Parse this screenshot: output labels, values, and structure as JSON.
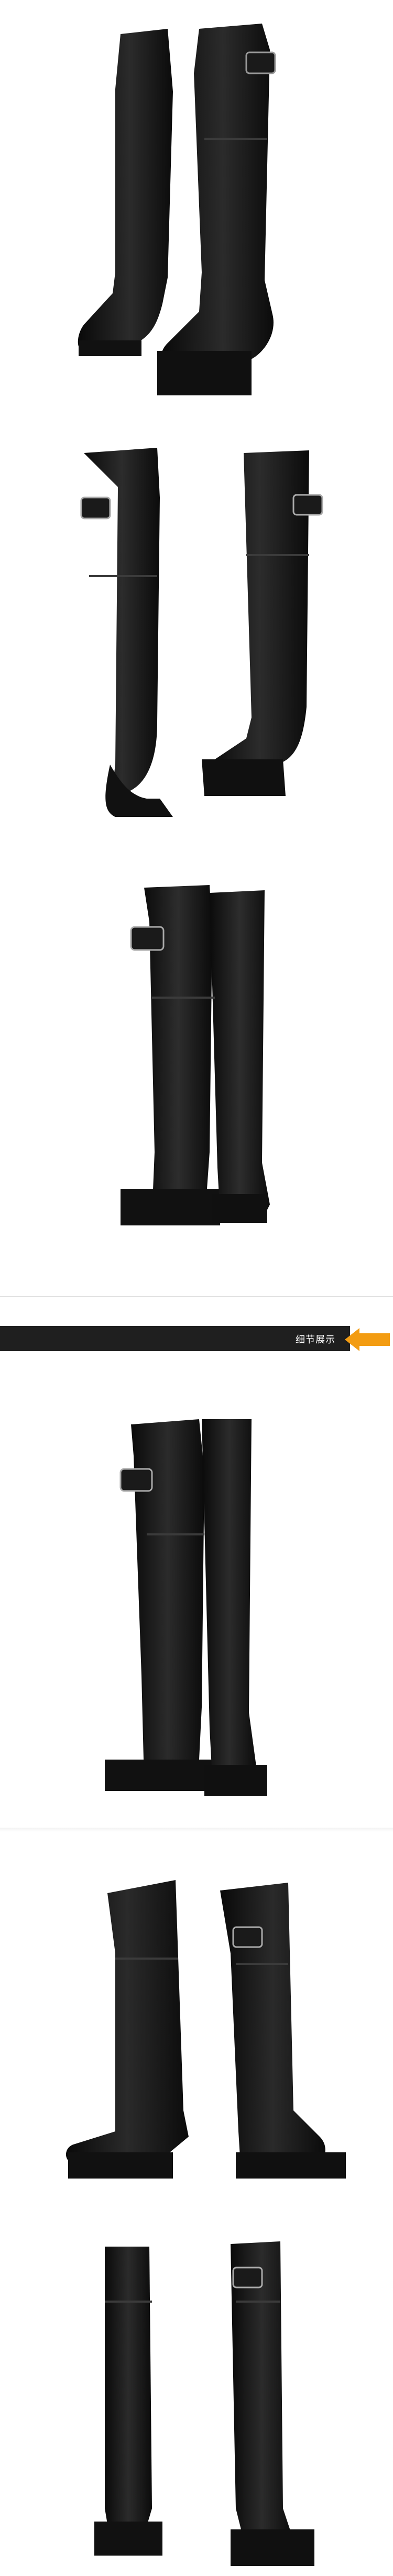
{
  "banner": {
    "title": "细节展示",
    "accent_color": "#f39c12",
    "bar_color": "#1f1f1f"
  },
  "product": {
    "color": "#101010",
    "icon": "over-the-knee-boots"
  }
}
